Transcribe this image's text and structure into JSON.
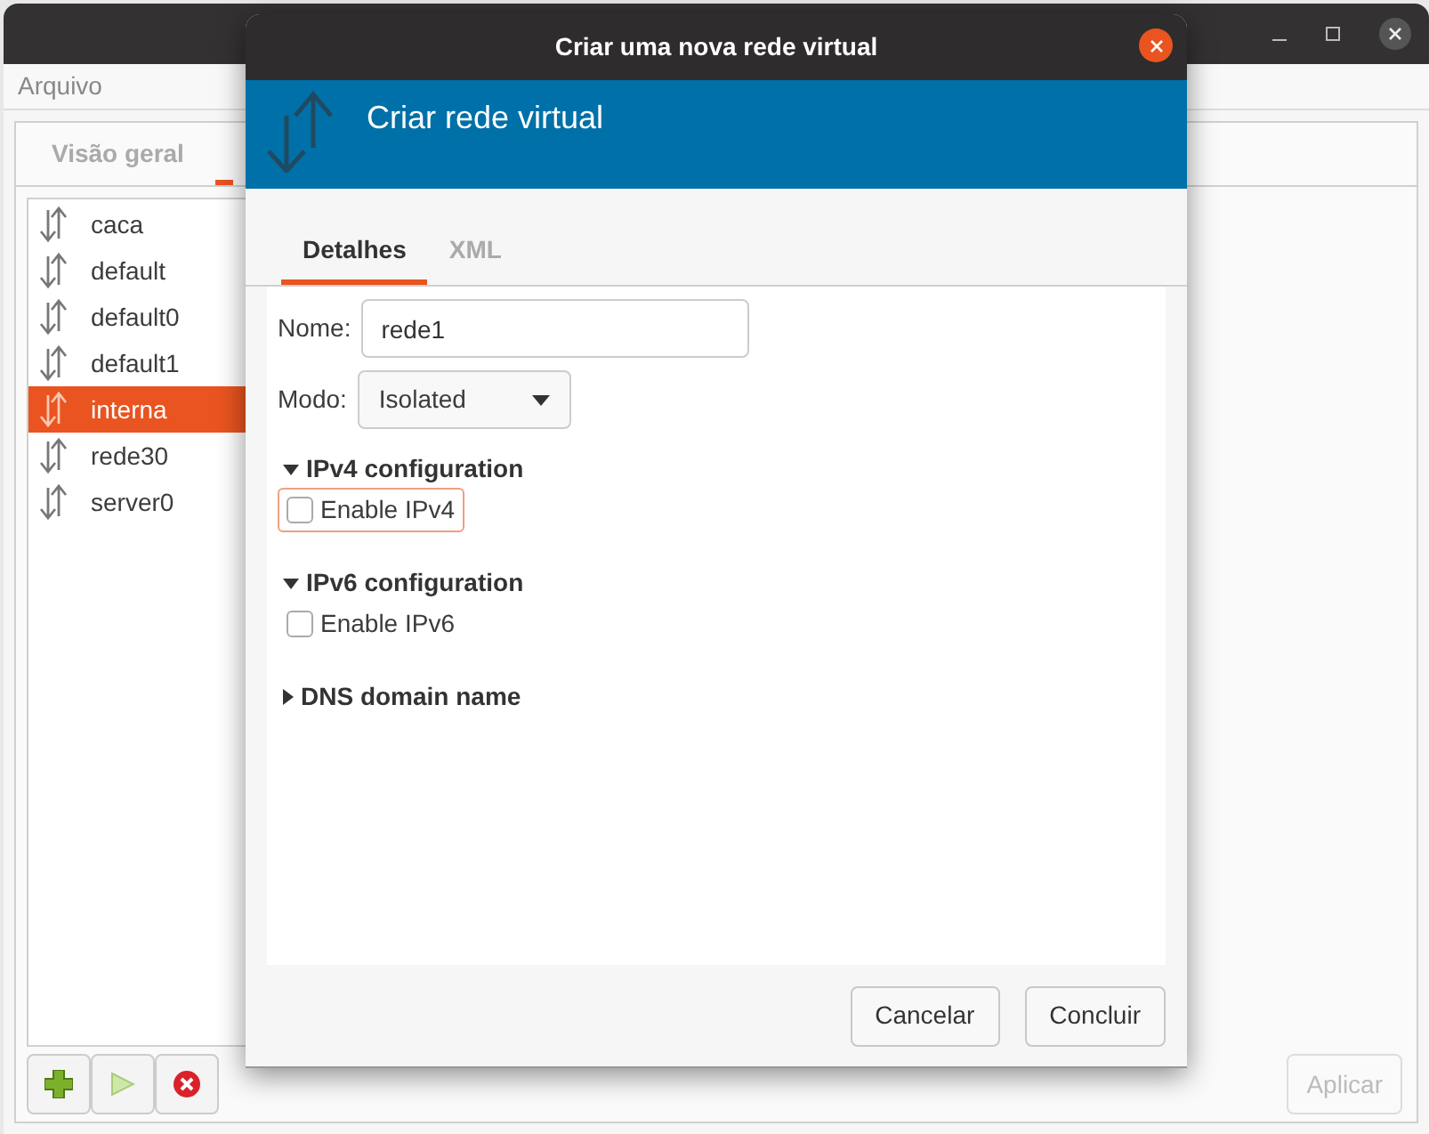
{
  "main_window": {
    "menu": [
      "Arquivo"
    ],
    "tabs": [
      {
        "label": "Visão geral",
        "selected": false
      }
    ],
    "networks": [
      {
        "name": "caca",
        "selected": false
      },
      {
        "name": "default",
        "selected": false
      },
      {
        "name": "default0",
        "selected": false
      },
      {
        "name": "default1",
        "selected": false
      },
      {
        "name": "interna",
        "selected": true
      },
      {
        "name": "rede30",
        "selected": false
      },
      {
        "name": "server0",
        "selected": false
      }
    ],
    "apply_button": {
      "label": "Aplicar",
      "disabled": true
    }
  },
  "dialog": {
    "title": "Criar uma nova rede virtual",
    "banner": "Criar rede virtual",
    "tabs": [
      {
        "label": "Detalhes",
        "selected": true
      },
      {
        "label": "XML",
        "selected": false
      }
    ],
    "name_field": {
      "label": "Nome:",
      "value": "rede1"
    },
    "mode": {
      "label": "Modo:",
      "value": "Isolated"
    },
    "sections": [
      {
        "title": "IPv4 configuration",
        "expanded": true,
        "checkbox": {
          "label": "Enable IPv4",
          "checked": false,
          "focused": true
        }
      },
      {
        "title": "IPv6 configuration",
        "expanded": true,
        "checkbox": {
          "label": "Enable IPv6",
          "checked": false,
          "focused": false
        }
      },
      {
        "title": "DNS domain name",
        "expanded": false
      }
    ],
    "buttons": [
      "Cancelar",
      "Concluir"
    ]
  }
}
